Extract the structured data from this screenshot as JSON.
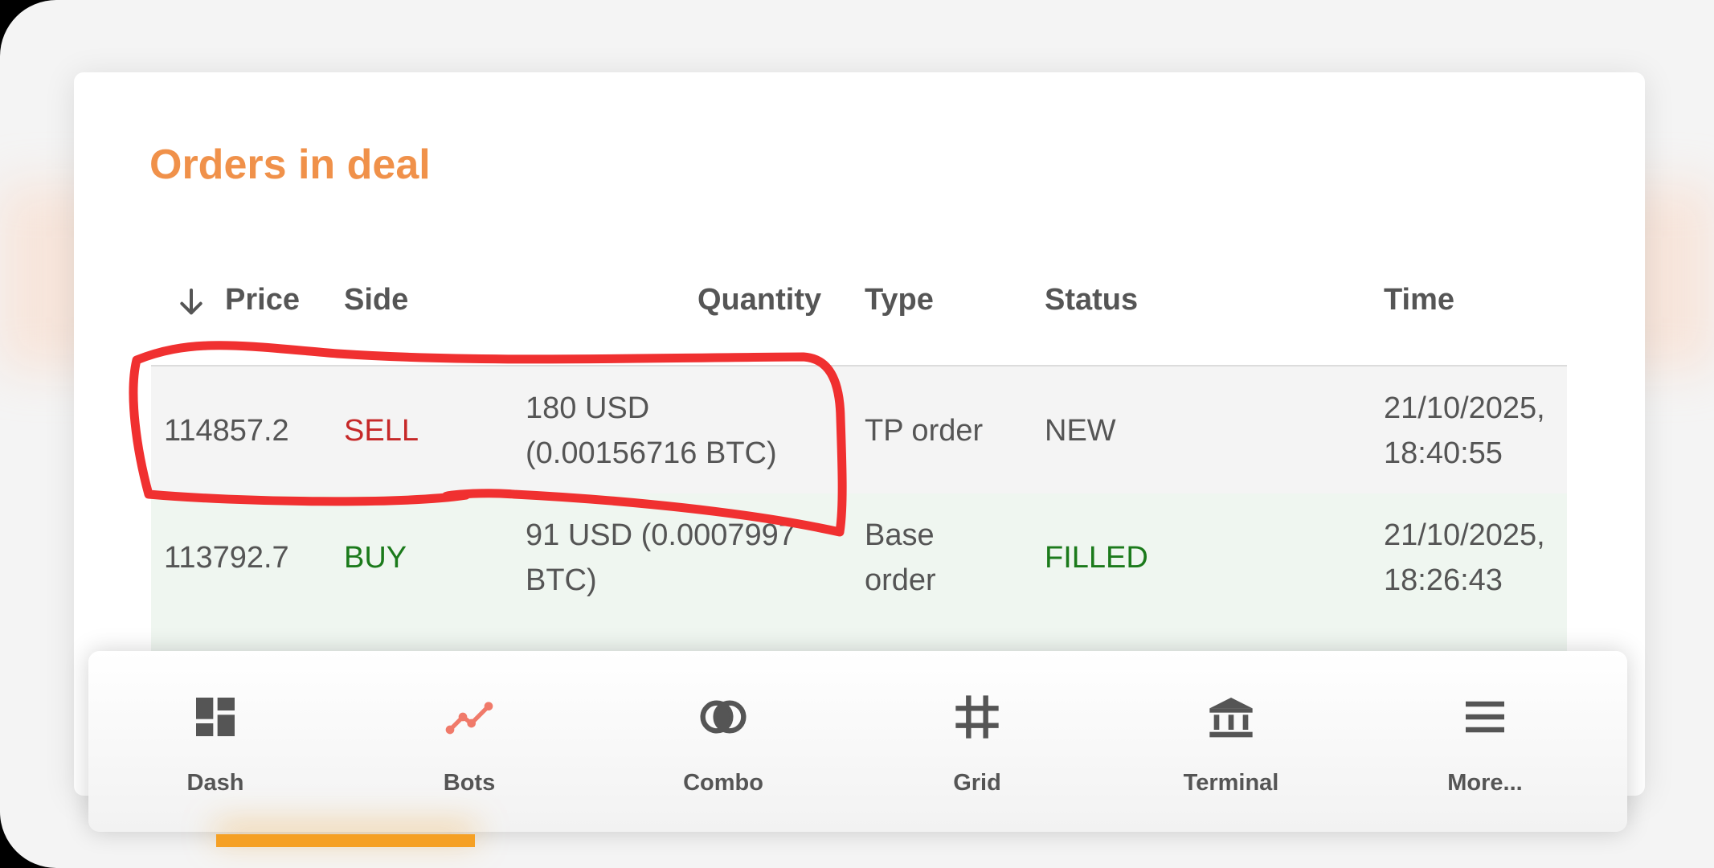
{
  "card": {
    "title": "Orders in deal"
  },
  "table": {
    "headers": {
      "price": "Price",
      "side": "Side",
      "quantity": "Quantity",
      "type": "Type",
      "status": "Status",
      "time": "Time"
    },
    "rows": [
      {
        "price": "114857.2",
        "side": "SELL",
        "quantity_line1": "180 USD",
        "quantity_line2": "(0.00156716 BTC)",
        "type_line1": "TP order",
        "type_line2": "",
        "status": "NEW",
        "time_line1": "21/10/2025,",
        "time_line2": "18:40:55"
      },
      {
        "price": "113792.7",
        "side": "BUY",
        "quantity_line1": "91 USD (0.0007997",
        "quantity_line2": "BTC)",
        "type_line1": "Base",
        "type_line2": "order",
        "status": "FILLED",
        "time_line1": "21/10/2025,",
        "time_line2": "18:26:43"
      }
    ]
  },
  "nav": {
    "items": [
      {
        "label": "Dash",
        "icon": "dashboard-icon"
      },
      {
        "label": "Bots",
        "icon": "bots-icon",
        "active": true
      },
      {
        "label": "Combo",
        "icon": "combo-icon"
      },
      {
        "label": "Grid",
        "icon": "grid-icon"
      },
      {
        "label": "Terminal",
        "icon": "terminal-icon"
      },
      {
        "label": "More...",
        "icon": "menu-icon"
      }
    ]
  },
  "colors": {
    "accent": "#f0914a",
    "sell": "#c62828",
    "buy": "#1b7a1b",
    "active_tab": "#f5a024",
    "annotation": "#f03030"
  }
}
